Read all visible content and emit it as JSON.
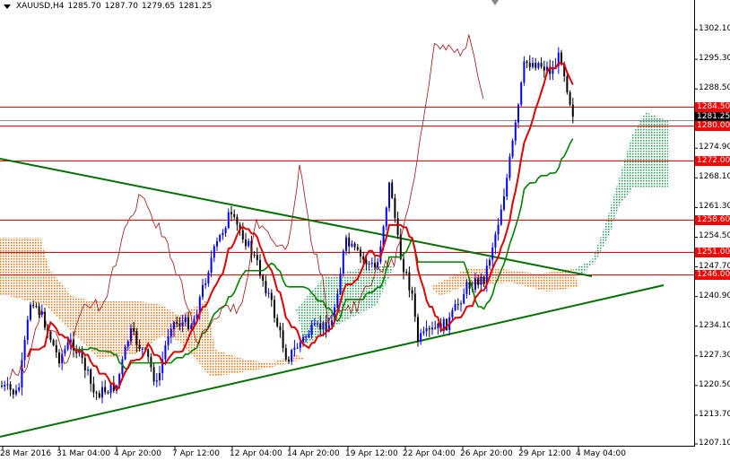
{
  "header": {
    "symbol": "XAUUSD,H4",
    "open": "1285.70",
    "high": "1287.70",
    "low": "1279.65",
    "close": "1281.25"
  },
  "price_axis": {
    "ticks": [
      "1302.10",
      "1295.30",
      "1288.50",
      "1274.90",
      "1268.10",
      "1261.30",
      "1254.50",
      "1247.70",
      "1240.90",
      "1234.10",
      "1227.30",
      "1220.50",
      "1213.70",
      "1207.10"
    ],
    "range": [
      1207.1,
      1302.1
    ]
  },
  "levels": [
    {
      "price": 1284.5,
      "label": "1284.50"
    },
    {
      "price": 1280.0,
      "label": "1280.00"
    },
    {
      "price": 1272.0,
      "label": "1272.00"
    },
    {
      "price": 1258.6,
      "label": "1258.60"
    },
    {
      "price": 1251.0,
      "label": "1251.00"
    },
    {
      "price": 1246.0,
      "label": "1246.00"
    }
  ],
  "current_price": {
    "price": 1281.25,
    "label": "1281.25"
  },
  "time_axis": [
    "28 Mar 2016",
    "31 Mar 04:00",
    "4 Apr 20:00",
    "7 Apr 12:00",
    "12 Apr 04:00",
    "14 Apr 20:00",
    "19 Apr 12:00",
    "22 Apr 04:00",
    "26 Apr 20:00",
    "29 Apr 12:00",
    "4 May 04:00"
  ],
  "colors": {
    "level": "#ff0000",
    "bull": "#0000ff",
    "bear": "#000000",
    "tenkan": "#e00000",
    "kijun": "#008000",
    "chikou": "#a01010",
    "trend": "#007000"
  }
}
